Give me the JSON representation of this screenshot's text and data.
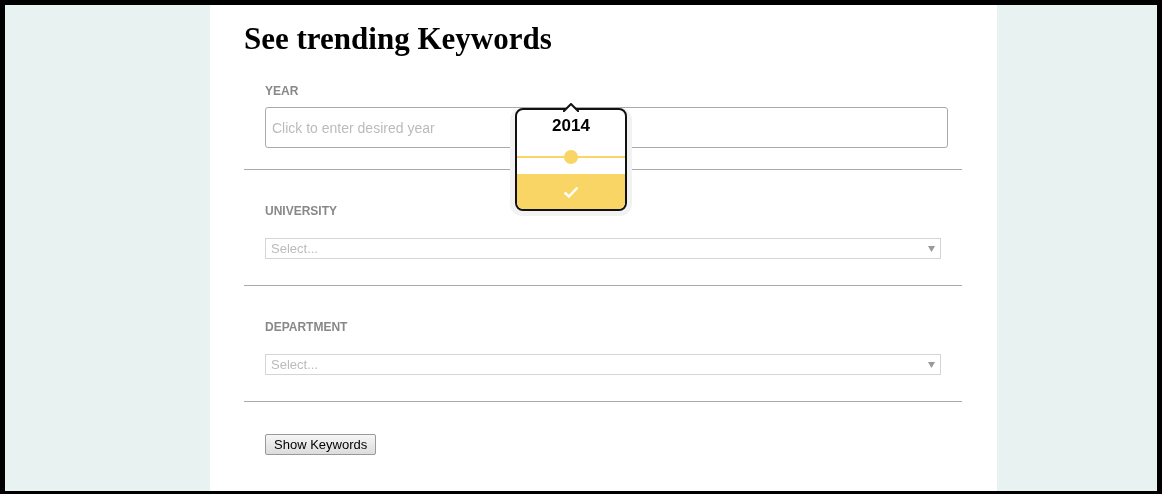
{
  "title": "See trending Keywords",
  "year": {
    "label": "YEAR",
    "placeholder": "Click to enter desired year",
    "picker": {
      "value": "2014",
      "level": 0.5
    }
  },
  "selects": [
    {
      "label": "UNIVERSITY",
      "placeholder": "Select..."
    },
    {
      "label": "DEPARTMENT",
      "placeholder": "Select..."
    }
  ],
  "button": "Show Keywords"
}
